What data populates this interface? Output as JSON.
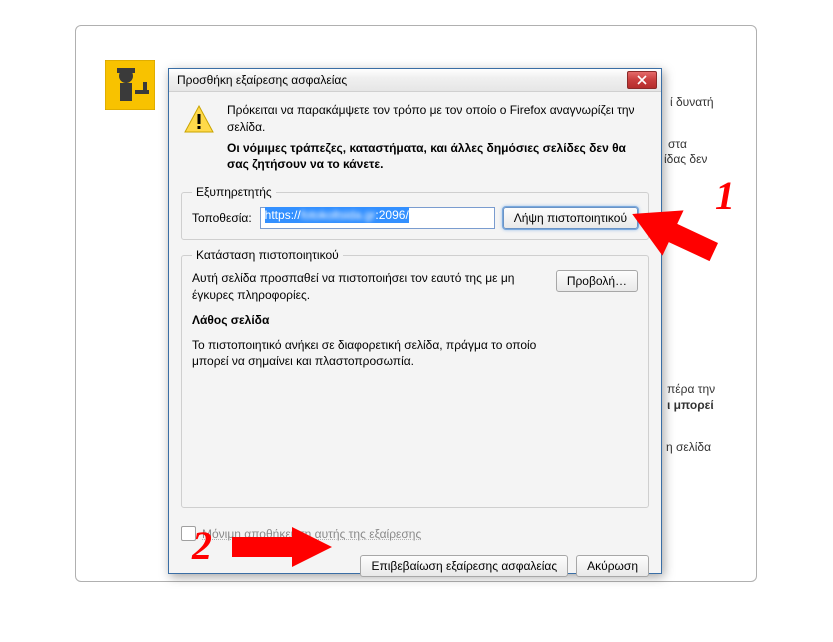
{
  "dialog": {
    "title": "Προσθήκη εξαίρεσης ασφαλείας",
    "intro": "Πρόκειται να παρακάμψετε τον τρόπο με τον οποίο ο Firefox αναγνωρίζει την σελίδα.",
    "warning": "Οι νόμιμες τράπεζες, καταστήματα, και άλλες δημόσιες σελίδες δεν θα σας ζητήσουν να το κάνετε.",
    "server_group": "Εξυπηρετητής",
    "location_label": "Τοποθεσία:",
    "location_prefix": "https://",
    "location_suffix": ":2096/",
    "get_cert_btn": "Λήψη πιστοποιητικού",
    "status_group": "Κατάσταση πιστοποιητικού",
    "status_text": "Αυτή σελίδα προσπαθεί να πιστοποιήσει τον εαυτό της με μη έγκυρες πληροφορίες.",
    "view_btn": "Προβολή…",
    "wrong_site": "Λάθος σελίδα",
    "wrong_site_desc": "Το πιστοποιητικό ανήκει σε διαφορετική σελίδα, πράγμα το οποίο μπορεί να σημαίνει και πλαστοπροσωπία.",
    "permanent_label": "Μόνιμη αποθήκευση αυτής της εξαίρεσης",
    "confirm_btn": "Επιβεβαίωση εξαίρεσης ασφαλείας",
    "cancel_btn": "Ακύρωση"
  },
  "background": {
    "frag1": "ί δυνατή",
    "frag2": "στα",
    "frag3": "ίδας δεν",
    "frag4": "πέρα την",
    "frag5": "ι μπορεί",
    "frag6": "η σελίδα"
  },
  "annotations": {
    "step1": "1",
    "step2": "2"
  }
}
